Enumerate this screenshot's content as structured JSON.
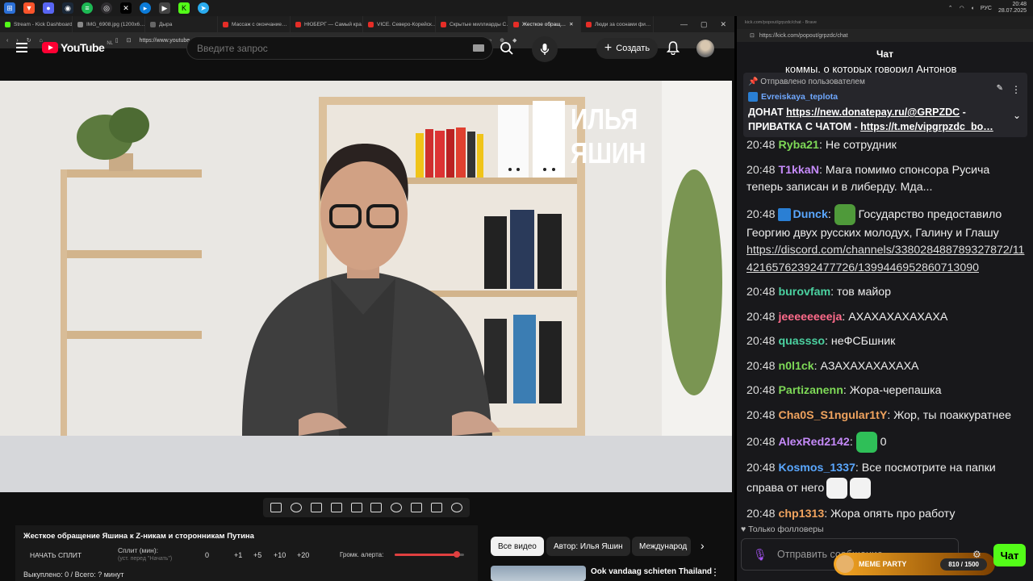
{
  "taskbar": {
    "apps": [
      "brave",
      "discord",
      "steam",
      "spotify",
      "obs",
      "capcut",
      "edge",
      "media",
      "kick",
      "telegram"
    ],
    "lang": "РУС",
    "time": "20:48",
    "date": "28.07.2025"
  },
  "browser": {
    "tabs": [
      {
        "label": "Stream - Kick Dashboard",
        "color": "#53fc18"
      },
      {
        "label": "IMG_6908.jpg (1200x6…",
        "color": "#888888"
      },
      {
        "label": "Дыра",
        "color": "#666666"
      },
      {
        "label": "Массаж с окончание…",
        "color": "#e52d27"
      },
      {
        "label": "НЮБЕРГ — Самый кра…",
        "color": "#e52d27"
      },
      {
        "label": "VICE. Северо-Корейск…",
        "color": "#e52d27"
      },
      {
        "label": "Скрытые миллиарды С…",
        "color": "#e52d27"
      },
      {
        "label": "Жесткое обращ…",
        "color": "#e52d27",
        "active": true
      },
      {
        "label": "Люди за соснами фи…",
        "color": "#e52d27"
      }
    ],
    "url": "https://www.youtube.com/watch?v=UfdCihPdgSI"
  },
  "youtube": {
    "logo": "YouTube",
    "region": "NL",
    "search_placeholder": "Введите запрос",
    "create_label": "Создать"
  },
  "video": {
    "overlay_title": "ИЛЬЯ ЯШИН"
  },
  "split": {
    "title": "Жесткое обращение Яшина к Z-никам и сторонникам Путина",
    "start_label": "НАЧАТЬ СПЛИТ",
    "split_label": "Сплит (мин):",
    "split_sub": "(уст. перед \"Начать\")",
    "values": [
      "0",
      "+1",
      "+5",
      "+10",
      "+20"
    ],
    "volume_label": "Громк. алерта:",
    "volume_level": 0.9,
    "stats": "Выкуплено: 0 / Всего: ? минут"
  },
  "chips": {
    "all": "Все видео",
    "author": "Автор: Илья Яшин",
    "intl": "Международ"
  },
  "recommendation": {
    "title": "Ook vandaag schieten Thailand"
  },
  "chat_window": {
    "title": "kick.com/popout/grpzdc/chat - Brave",
    "url": "https://kick.com/popout/grpzdc/chat",
    "header": "Чат",
    "scroll_cut": "коммы, о которых говорил Антонов",
    "pinned_by": "Отправлено пользователем",
    "pinned_user": "Evreiskaya_teplota",
    "pinned_line1_pre": "ДОНАТ ",
    "pinned_line1_link": "https://new.donatepay.ru/@GRPZDC",
    "pinned_line1_post": " -",
    "pinned_line2_pre": "ПРИВАТКА С ЧАТОМ - ",
    "pinned_line2_link": "https://t.me/vipgrpzdc_bo…",
    "footer": "Только фолловеры",
    "input_placeholder": "Отправить сообщение...",
    "send_label": "Чат",
    "meme_label": "MEME PARTY",
    "meme_progress": "810 / 1500"
  },
  "messages": [
    {
      "time": "20:48",
      "user": "Ryba21",
      "color": "#7ed957",
      "text": "Не сотрудник"
    },
    {
      "time": "20:48",
      "user": "T1kkaN",
      "color": "#c58af9",
      "text": "Мага помимо спонсора Русича теперь записан и в либерду. Мда..."
    },
    {
      "time": "20:48",
      "user": "Dunck",
      "color": "#5aa7ff",
      "text": "Государство предоставило Георгию двух русских молодух, Галину и Глашу",
      "link": "https://discord.com/channels/338028488789327872/1142165762392477726/1399446952860713090",
      "emote": "pepe",
      "badge": true
    },
    {
      "time": "20:48",
      "user": "burovfam",
      "color": "#4bd1a0",
      "text": "тов майор"
    },
    {
      "time": "20:48",
      "user": "jeeeeeeeeja",
      "color": "#ff6b8b",
      "text": "АХАХАХАХАХАХА"
    },
    {
      "time": "20:48",
      "user": "quassso",
      "color": "#4bd1a0",
      "text": "неФСБшник"
    },
    {
      "time": "20:48",
      "user": "n0l1ck",
      "color": "#7ed957",
      "text": "АЗАХАХАХАХАХА"
    },
    {
      "time": "20:48",
      "user": "Partizanenn",
      "color": "#7ed957",
      "text": "Жора-черепашка"
    },
    {
      "time": "20:48",
      "user": "Cha0S_S1ngular1tY",
      "color": "#f0a35e",
      "text": "Жор, ты поаккуратнее"
    },
    {
      "time": "20:48",
      "user": "AlexRed2142",
      "color": "#c58af9",
      "text": "0",
      "emote": "grin"
    },
    {
      "time": "20:48",
      "user": "Kosmos_1337",
      "color": "#5aa7ff",
      "text": "Все посмотрите на папки справа от него",
      "emote": "faces"
    },
    {
      "time": "20:48",
      "user": "chp1313",
      "color": "#f0a35e",
      "text": "Жора опять про работу"
    }
  ]
}
